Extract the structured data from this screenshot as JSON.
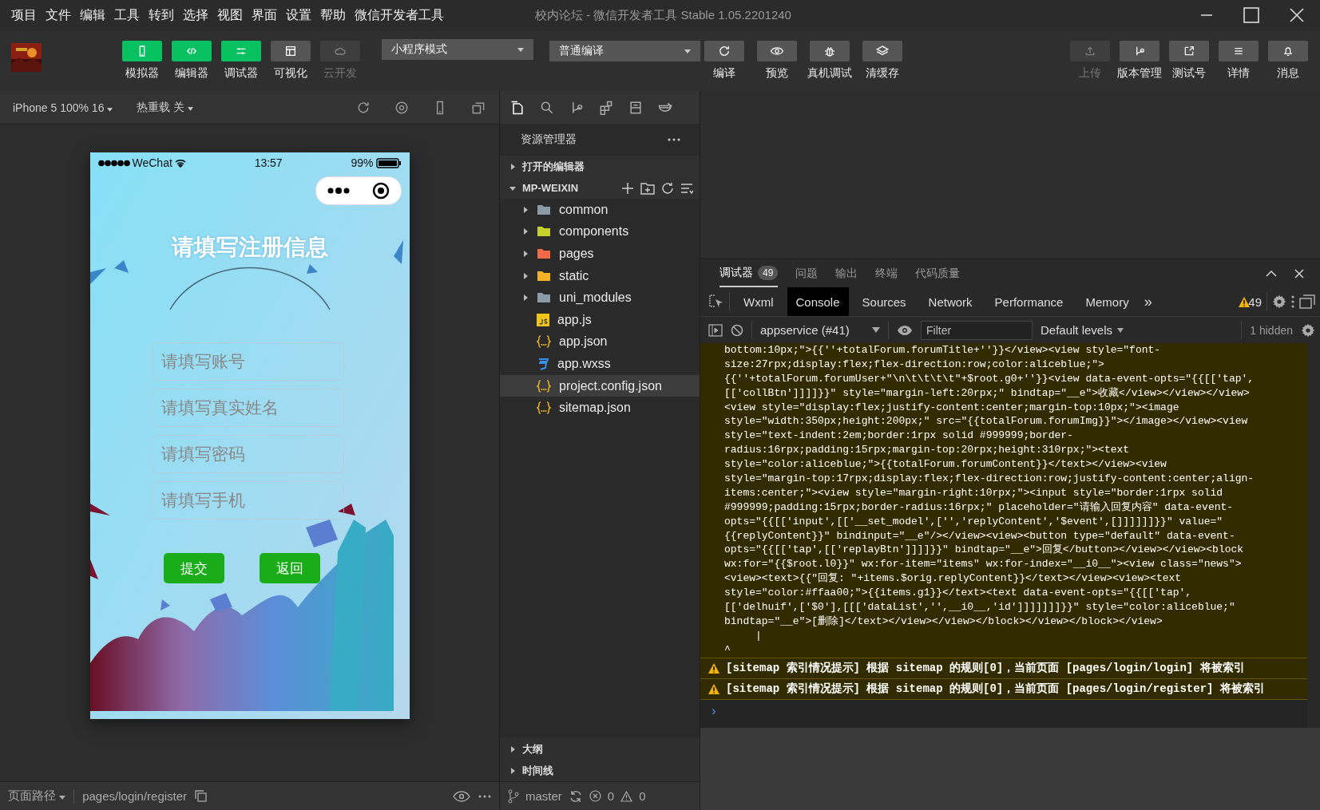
{
  "window": {
    "title": "校内论坛 - 微信开发者工具 Stable 1.05.2201240"
  },
  "menu": [
    "项目",
    "文件",
    "编辑",
    "工具",
    "转到",
    "选择",
    "视图",
    "界面",
    "设置",
    "帮助",
    "微信开发者工具"
  ],
  "toolbar": {
    "views": [
      {
        "label": "模拟器",
        "selected": true,
        "disabled": false
      },
      {
        "label": "编辑器",
        "selected": true,
        "disabled": false
      },
      {
        "label": "调试器",
        "selected": true,
        "disabled": false
      },
      {
        "label": "可视化",
        "selected": false,
        "disabled": false
      },
      {
        "label": "云开发",
        "selected": false,
        "disabled": true
      }
    ],
    "mode": "小程序模式",
    "compile_mode": "普通编译",
    "actions": [
      {
        "label": "编译"
      },
      {
        "label": "预览"
      },
      {
        "label": "真机调试"
      },
      {
        "label": "清缓存"
      }
    ],
    "right": [
      {
        "label": "上传",
        "disabled": true
      },
      {
        "label": "版本管理",
        "disabled": false
      },
      {
        "label": "测试号",
        "disabled": false
      },
      {
        "label": "详情",
        "disabled": false
      },
      {
        "label": "消息",
        "disabled": false
      }
    ]
  },
  "simulator": {
    "device": "iPhone 5 100% 16",
    "hot_reload": "热重载 关",
    "phone": {
      "carrier": "WeChat",
      "time": "13:57",
      "battery": "99%",
      "title": "请填写注册信息",
      "fields": [
        {
          "placeholder": "请填写账号"
        },
        {
          "placeholder": "请填写真实姓名"
        },
        {
          "placeholder": "请填写密码"
        },
        {
          "placeholder": "请填写手机"
        }
      ],
      "buttons": [
        "提交",
        "返回"
      ]
    },
    "path_label": "页面路径",
    "path": "pages/login/register"
  },
  "explorer": {
    "title": "资源管理器",
    "sections": [
      {
        "label": "打开的编辑器",
        "expanded": false
      },
      {
        "label": "MP-WEIXIN",
        "expanded": true
      }
    ],
    "items": [
      {
        "name": "common",
        "kind": "folder",
        "expanded": false,
        "selected": false
      },
      {
        "name": "components",
        "kind": "components",
        "expanded": false,
        "selected": false
      },
      {
        "name": "pages",
        "kind": "pages",
        "expanded": false,
        "selected": false
      },
      {
        "name": "static",
        "kind": "static",
        "expanded": false,
        "selected": false
      },
      {
        "name": "uni_modules",
        "kind": "folder",
        "expanded": false,
        "selected": false
      },
      {
        "name": "app.js",
        "kind": "js",
        "selected": false
      },
      {
        "name": "app.json",
        "kind": "json",
        "selected": false
      },
      {
        "name": "app.wxss",
        "kind": "css",
        "selected": false
      },
      {
        "name": "project.config.json",
        "kind": "json",
        "selected": true
      },
      {
        "name": "sitemap.json",
        "kind": "json",
        "selected": false
      }
    ],
    "bottom_sections": [
      {
        "label": "大纲",
        "expanded": false
      },
      {
        "label": "时间线",
        "expanded": false
      }
    ],
    "branch": "master",
    "errors": "0",
    "warnings": "0"
  },
  "devtools": {
    "tabs": [
      {
        "label": "调试器",
        "badge": "49",
        "selected": true
      },
      {
        "label": "问题",
        "selected": false
      },
      {
        "label": "输出",
        "selected": false
      },
      {
        "label": "终端",
        "selected": false
      },
      {
        "label": "代码质量",
        "selected": false
      }
    ],
    "panels": [
      {
        "label": "Wxml",
        "selected": false
      },
      {
        "label": "Console",
        "selected": true
      },
      {
        "label": "Sources",
        "selected": false
      },
      {
        "label": "Network",
        "selected": false
      },
      {
        "label": "Performance",
        "selected": false
      },
      {
        "label": "Memory",
        "selected": false
      }
    ],
    "more": "»",
    "warning_count": "49",
    "context": "appservice (#41)",
    "filter_placeholder": "Filter",
    "levels": "Default levels",
    "hidden": "1 hidden",
    "messages": [
      {
        "kind": "error",
        "lines": [
          "bottom:10px;\">{{''+totalForum.forumTitle+''}}</view><view style=\"font-",
          "size:27rpx;display:flex;flex-direction:row;color:aliceblue;\">",
          "{{''+totalForum.forumUser+\"\\n\\t\\t\\t\\t\"+$root.g0+''}}<view data-event-opts=\"{{[['tap',",
          "[['collBtn']]]]}}\" style=\"margin-left:20rpx;\" bindtap=\"__e\">收藏</view></view></view>",
          "<view style=\"display:flex;justify-content:center;margin-top:10px;\"><image",
          "style=\"width:350px;height:200px;\" src=\"{{totalForum.forumImg}}\"></image></view><view",
          "style=\"text-indent:2em;border:1rpx solid #999999;border-",
          "radius:16rpx;padding:15rpx;margin-top:20rpx;height:310rpx;\"><text",
          "style=\"color:aliceblue;\">{{totalForum.forumContent}}</text></view><view",
          "style=\"margin-top:17rpx;display:flex;flex-direction:row;justify-content:center;align-",
          "items:center;\"><view style=\"margin-right:10rpx;\"><input style=\"border:1rpx solid",
          "#999999;padding:15rpx;border-radius:16rpx;\" placeholder=\"请输入回复内容\" data-event-",
          "opts=\"{{[['input',[['__set_model',['','replyContent','$event',[]]]]]]}}\" value=\"",
          "{{replyContent}}\" bindinput=\"__e\"/></view><view><button type=\"default\" data-event-",
          "opts=\"{{[['tap',[['replayBtn']]]]}}\" bindtap=\"__e\">回复</button></view></view><block",
          "wx:for=\"{{$root.l0}}\" wx:for-item=\"items\" wx:for-index=\"__i0__\"><view class=\"news\">",
          "<view><text>{{\"回复: \"+items.$orig.replyContent}}</text></view><view><text",
          "style=\"color:#ffaa00;\">{{items.g1}}</text><text data-event-opts=\"{{[['tap',",
          "[['delhuif',['$0'],[[['dataList','',__i0__,'id']]]]]]]}}\" style=\"color:aliceblue;\"",
          "bindtap=\"__e\">[删除]</text></view></view></block></view></block></view>",
          "     |",
          "^"
        ]
      },
      {
        "kind": "warning",
        "text": "[sitemap 索引情况提示] 根据 sitemap 的规则[0]，当前页面 [pages/login/login] 将被索引"
      },
      {
        "kind": "warning",
        "text": "[sitemap 索引情况提示] 根据 sitemap 的规则[0]，当前页面 [pages/login/register] 将被索引"
      }
    ],
    "prompt": "›"
  }
}
